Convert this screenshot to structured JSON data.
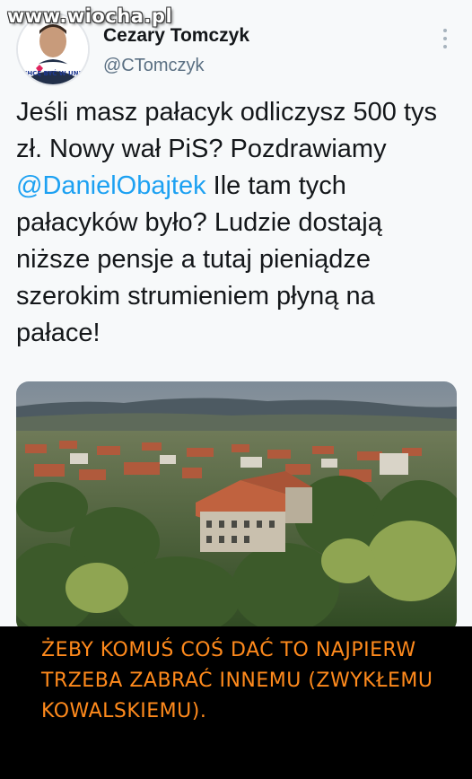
{
  "watermark": "www.wiocha.pl",
  "author": {
    "name": "Cezary Tomczyk",
    "handle": "@CTomczyk",
    "avatar_badge": "CHCĘ BYĆ W UNII"
  },
  "tweet": {
    "text_before": "Jeśli masz pałacyk odliczysz 500 tys zł. Nowy wał PiS? Pozdrawiamy ",
    "mention": "@DanielObajtek",
    "text_after": " Ile tam tych pałacyków było? Ludzie dostają niższe pensje a tutaj pieniądze szerokim strumieniem płyną na pałace!"
  },
  "photo": {
    "description_icon": "town-aerial-photo"
  },
  "caption": {
    "text": "ŻEBY KOMUŚ COŚ DAĆ TO NAJPIERW TRZEBA ZABRAĆ INNEMU (ZWYKŁEMU KOWALSKIEMU)."
  },
  "colors": {
    "mention": "#1da1f2",
    "caption": "#ff8a1c",
    "caption_bg": "#000000"
  }
}
